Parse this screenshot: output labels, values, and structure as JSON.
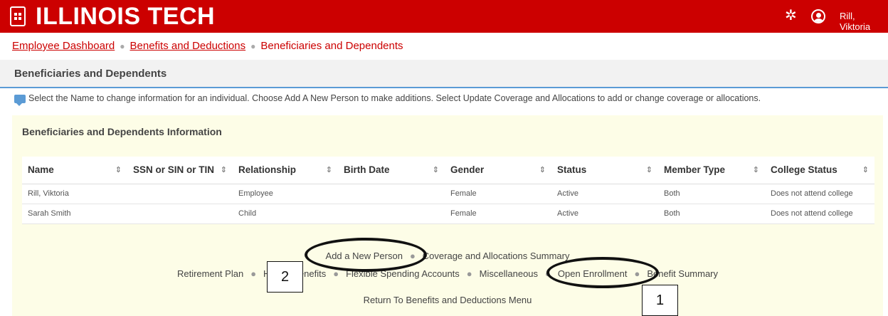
{
  "header": {
    "logo": "ILLINOIS TECH",
    "user_name": "Rill, Viktoria",
    "gear_icon": "gear-icon",
    "user_icon": "user-icon",
    "menu_icon": "app-grid-icon"
  },
  "breadcrumb": {
    "items": [
      "Employee Dashboard",
      "Benefits and Deductions"
    ],
    "current": "Beneficiaries and Dependents"
  },
  "page_title": "Beneficiaries and Dependents",
  "info_message": "Select the Name to change information for an individual. Choose Add A New Person to make additions. Select Update Coverage and Allocations to add or change coverage or allocations.",
  "panel": {
    "title": "Beneficiaries and Dependents Information",
    "columns": [
      "Name",
      "SSN or SIN or TIN",
      "Relationship",
      "Birth Date",
      "Gender",
      "Status",
      "Member Type",
      "College Status"
    ],
    "rows": [
      [
        "Rill, Viktoria",
        "",
        "Employee",
        "",
        "Female",
        "Active",
        "Both",
        "Does not attend college"
      ],
      [
        "Sarah Smith",
        "",
        "Child",
        "",
        "Female",
        "Active",
        "Both",
        "Does not attend college"
      ]
    ]
  },
  "links": {
    "row1": [
      "Add a New Person",
      "Coverage and Allocations Summary"
    ],
    "row2": [
      "Retirement Plan",
      "Health Benefits",
      "Flexible Spending Accounts",
      "Miscellaneous",
      "Open Enrollment",
      "Benefit Summary"
    ],
    "row3": "Return To Benefits and Deductions Menu"
  },
  "annotations": {
    "callout_1": "1",
    "callout_2": "2"
  },
  "colors": {
    "brand_red": "#cc0000",
    "panel_bg": "#fdfde7",
    "accent_blue": "#5b9bd5"
  }
}
